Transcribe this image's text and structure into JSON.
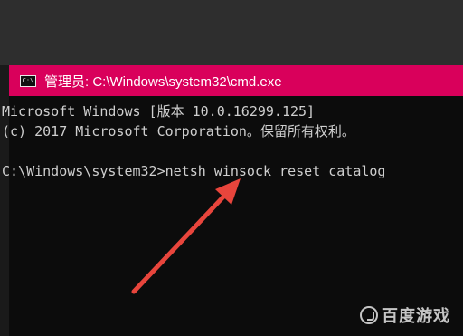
{
  "window": {
    "title": "管理员: C:\\Windows\\system32\\cmd.exe",
    "icon_label": "C:\\",
    "title_bar_color": "#d9005b"
  },
  "console": {
    "lines": [
      "Microsoft Windows [版本 10.0.16299.125]",
      "(c) 2017 Microsoft Corporation。保留所有权利。",
      "",
      "C:\\Windows\\system32>netsh winsock reset catalog"
    ]
  },
  "annotation": {
    "arrow_color": "#e8453c"
  },
  "watermark": {
    "text": "百度游戏",
    "icon": "baidu-games-logo-icon"
  }
}
